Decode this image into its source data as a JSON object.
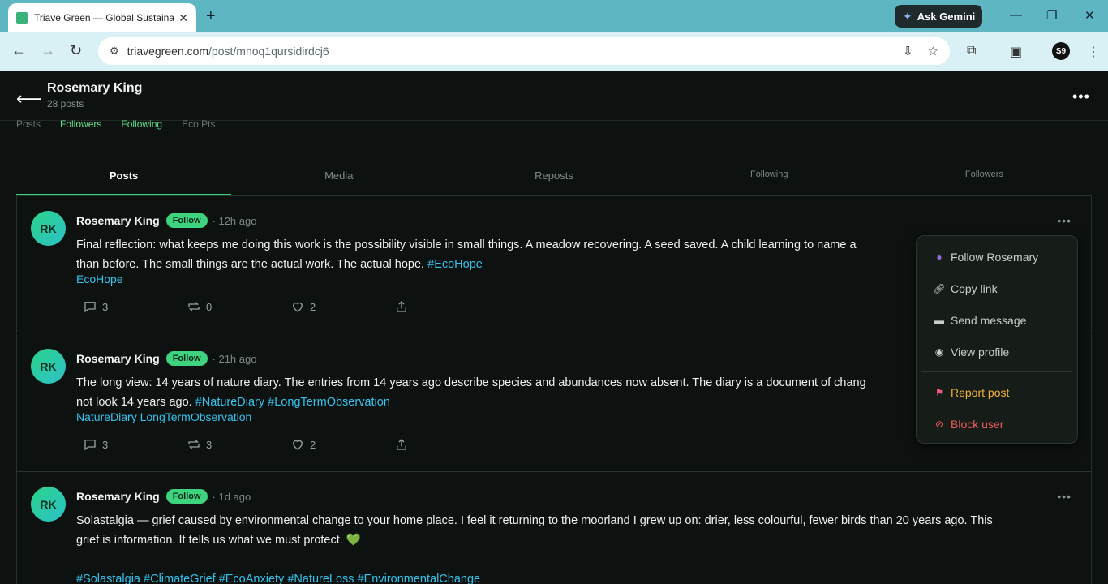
{
  "browser": {
    "tab_title": "Triave Green — Global Sustaina",
    "url_host": "triavegreen.com",
    "url_path": "/post/mnoq1qursidirdcj6",
    "gemini_label": "Ask Gemini",
    "profile_initials": "S9"
  },
  "header": {
    "name": "Rosemary King",
    "post_count": "28 posts"
  },
  "stats": [
    "Posts",
    "Followers",
    "Following",
    "Eco Pts"
  ],
  "tabs": [
    "Posts",
    "Media",
    "Reposts",
    "Following",
    "Followers"
  ],
  "posts": [
    {
      "initials": "RK",
      "name": "Rosemary King",
      "follow": "Follow",
      "time": "· 12h ago",
      "text_line1": "Final reflection: what keeps me doing this work is the possibility visible in small things. A meadow recovering. A seed saved. A child learning to name a",
      "text_line2": "than before. The small things are the actual work. The actual hope.",
      "hashtags_inline": "#EcoHope",
      "tags": "EcoHope",
      "comments": "3",
      "reposts": "0",
      "likes": "2"
    },
    {
      "initials": "RK",
      "name": "Rosemary King",
      "follow": "Follow",
      "time": "· 21h ago",
      "text_line1": "The long view: 14 years of nature diary. The entries from 14 years ago describe species and abundances now absent. The diary is a document of chang",
      "text_line2": "not look 14 years ago.",
      "hashtags_inline": "#NatureDiary #LongTermObservation",
      "tags": "NatureDiary LongTermObservation",
      "comments": "3",
      "reposts": "3",
      "likes": "2"
    },
    {
      "initials": "RK",
      "name": "Rosemary King",
      "follow": "Follow",
      "time": "· 1d ago",
      "text_line1": "Solastalgia — grief caused by environmental change to your home place. I feel it returning to the moorland I grew up on: drier, less colourful, fewer birds than 20 years ago. This",
      "text_line2": "grief is information. It tells us what we must protect. 💚",
      "hashtags_inline": "#Solastalgia #ClimateGrief #EcoAnxiety #NatureLoss #EnvironmentalChange"
    }
  ],
  "menu": {
    "follow": "Follow Rosemary",
    "copy": "Copy link",
    "message": "Send message",
    "view": "View profile",
    "report": "Report post",
    "block": "Block user"
  },
  "colors": {
    "accent_green": "#3ed37f",
    "hashtag_blue": "#33c3ee",
    "warn": "#f2b13a",
    "danger": "#ef5b5b"
  }
}
